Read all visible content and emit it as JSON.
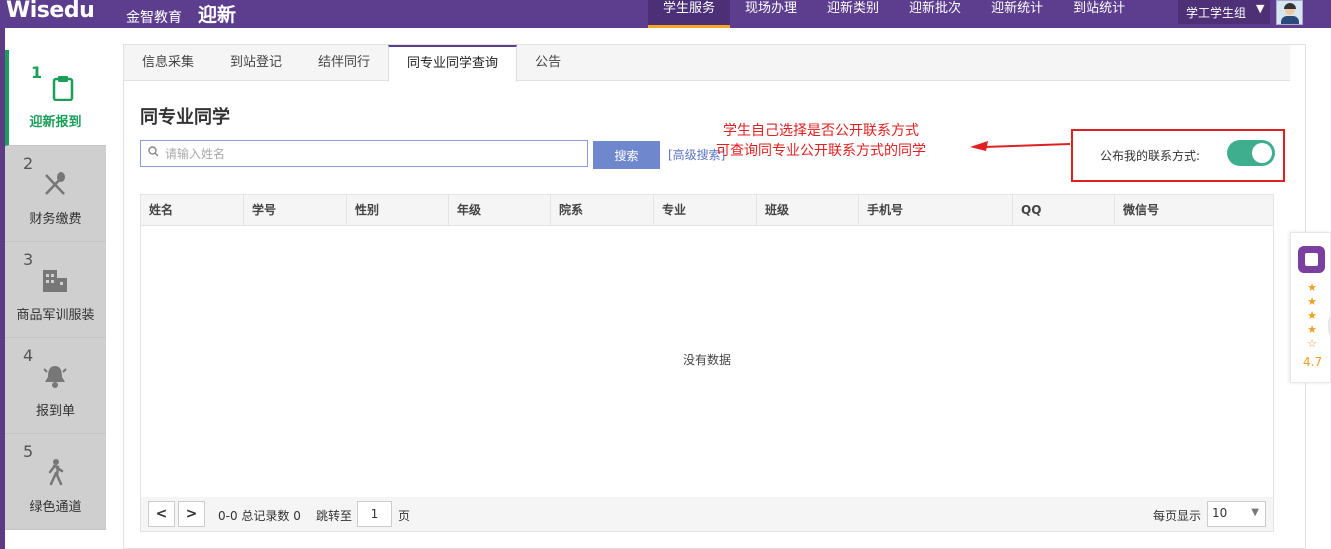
{
  "header": {
    "brand": "Wisedu",
    "brand_cn": "金智教育",
    "app_name": "迎新",
    "nav": [
      "学生服务",
      "现场办理",
      "迎新类别",
      "迎新批次",
      "迎新统计",
      "到站统计"
    ],
    "active_nav": 0,
    "user_group": "学工学生组"
  },
  "steps": [
    {
      "num": "1",
      "label": "迎新报到",
      "icon": "clipboard-icon",
      "active": true
    },
    {
      "num": "2",
      "label": "财务缴费",
      "icon": "fork-spoon-icon",
      "active": false
    },
    {
      "num": "3",
      "label": "商品军训服装",
      "icon": "building-icon",
      "active": false
    },
    {
      "num": "4",
      "label": "报到单",
      "icon": "bell-icon",
      "active": false
    },
    {
      "num": "5",
      "label": "绿色通道",
      "icon": "walker-icon",
      "active": false
    }
  ],
  "tabs": [
    "信息采集",
    "到站登记",
    "结伴同行",
    "同专业同学查询",
    "公告"
  ],
  "active_tab": 3,
  "section_title": "同专业同学",
  "search": {
    "placeholder": "请输入姓名",
    "button": "搜索",
    "advanced": "[高级搜索]"
  },
  "annotation": {
    "line1": "学生自己选择是否公开联系方式",
    "line2": "可查询同专业公开联系方式的同学",
    "color": "#e02020"
  },
  "publish": {
    "label": "公布我的联系方式:",
    "enabled": true,
    "toggle_color": "#3fae8f"
  },
  "table": {
    "columns": [
      "姓名",
      "学号",
      "性别",
      "年级",
      "院系",
      "专业",
      "班级",
      "手机号",
      "QQ",
      "微信号"
    ],
    "rows": [],
    "empty_text": "没有数据"
  },
  "pager": {
    "prev": "<",
    "next": ">",
    "info": "0-0 总记录数 0",
    "jump_label": "跳转至",
    "page_value": "1",
    "page_unit": "页",
    "per_page_label": "每页显示",
    "per_page_value": "10"
  },
  "rating_widget": {
    "stars": 4,
    "score": "4.7"
  },
  "colors": {
    "header": "#5d3d8e",
    "accent_nav": "#f5a623",
    "step_active": "#1a9e5a",
    "search_button": "#6f87cc"
  }
}
